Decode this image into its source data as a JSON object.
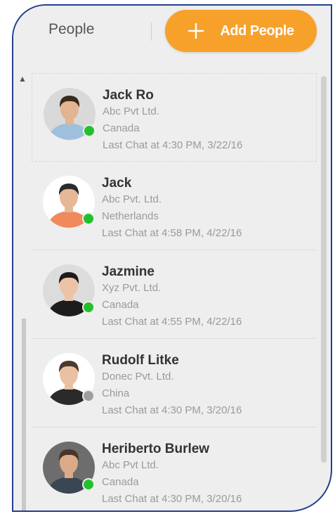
{
  "header": {
    "title": "People",
    "add_button_label": "Add People",
    "add_button_color": "#f7a12b"
  },
  "status_colors": {
    "online": "#22c12b",
    "offline": "#9e9e9e"
  },
  "people": [
    {
      "name": "Jack Ro",
      "company": "Abc Pvt Ltd.",
      "country": "Canada",
      "last_chat": "Last Chat at 4:30 PM, 3/22/16",
      "status": "online",
      "skin": "#e2b48f",
      "hair": "#3a2a1e",
      "suit": "#9fc0dd",
      "bg": "#d9d9d9"
    },
    {
      "name": "Jack",
      "company": "Abc Pvt. Ltd.",
      "country": "Netherlands",
      "last_chat": "Last Chat at 4:58 PM, 4/22/16",
      "status": "online",
      "skin": "#e6b896",
      "hair": "#2b2b2b",
      "suit": "#f08a5d",
      "bg": "#ffffff"
    },
    {
      "name": "Jazmine",
      "company": "Xyz Pvt. Ltd.",
      "country": "Canada",
      "last_chat": "Last Chat at 4:55 PM, 4/22/16",
      "status": "online",
      "skin": "#edc3a6",
      "hair": "#1e1a18",
      "suit": "#1c1c1c",
      "bg": "#dcdcdc"
    },
    {
      "name": "Rudolf Litke",
      "company": "Donec Pvt. Ltd.",
      "country": "China",
      "last_chat": "Last Chat at 4:30 PM, 3/20/16",
      "status": "offline",
      "skin": "#e9c0a2",
      "hair": "#4a3a30",
      "suit": "#2a2a2a",
      "bg": "#ffffff"
    },
    {
      "name": "Heriberto Burlew",
      "company": "Abc Pvt Ltd.",
      "country": "Canada",
      "last_chat": "Last Chat at 4:30 PM, 3/20/16",
      "status": "online",
      "skin": "#d9ab88",
      "hair": "#4a3426",
      "suit": "#3b4654",
      "bg": "#6d6d6d"
    }
  ]
}
